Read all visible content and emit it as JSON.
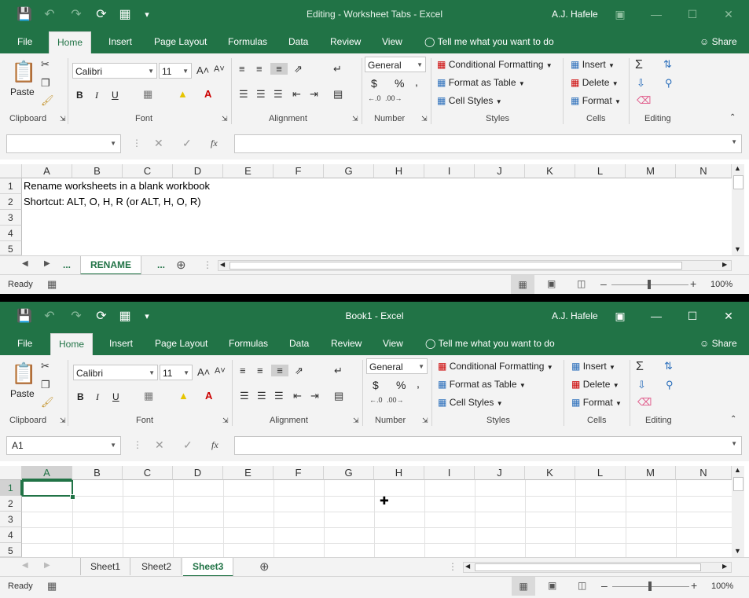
{
  "colors": {
    "brand": "#217346",
    "ribbon_bg": "#f3f3f3",
    "selection": "#217346"
  },
  "tabs": [
    "File",
    "Home",
    "Insert",
    "Page Layout",
    "Formulas",
    "Data",
    "Review",
    "View"
  ],
  "tell_me": "Tell me what you want to do",
  "share": "Share",
  "user": "A.J. Hafele",
  "ribbon": {
    "paste": "Paste",
    "font_name": "Calibri",
    "font_size": "11",
    "bold": "B",
    "italic": "I",
    "underline": "U",
    "number_format": "General",
    "currency": "$",
    "percent": "%",
    "comma": ",",
    "cond_format": "Conditional Formatting",
    "format_table": "Format as Table",
    "cell_styles": "Cell Styles",
    "insert": "Insert",
    "delete": "Delete",
    "format": "Format",
    "groups": [
      "Clipboard",
      "Font",
      "Alignment",
      "Number",
      "Styles",
      "Cells",
      "Editing"
    ]
  },
  "fx": "fx",
  "columns": [
    "A",
    "B",
    "C",
    "D",
    "E",
    "F",
    "G",
    "H",
    "I",
    "J",
    "K",
    "L",
    "M",
    "N"
  ],
  "rows": [
    "1",
    "2",
    "3",
    "4",
    "5"
  ],
  "status": {
    "ready": "Ready",
    "zoom": "100%"
  },
  "window1": {
    "title": "Editing - Worksheet Tabs  -  Excel",
    "namebox": "",
    "cells": {
      "A1": "Rename worksheets in a blank workbook",
      "A2": "Shortcut: ALT, O, H, R (or ALT, H, O, R)"
    },
    "sheet_tabs": [
      "...",
      "RENAME",
      "..."
    ],
    "active_sheet": "RENAME"
  },
  "window2": {
    "title": "Book1  -  Excel",
    "namebox": "A1",
    "sheet_tabs": [
      "Sheet1",
      "Sheet2",
      "Sheet3"
    ],
    "active_sheet": "Sheet3"
  }
}
